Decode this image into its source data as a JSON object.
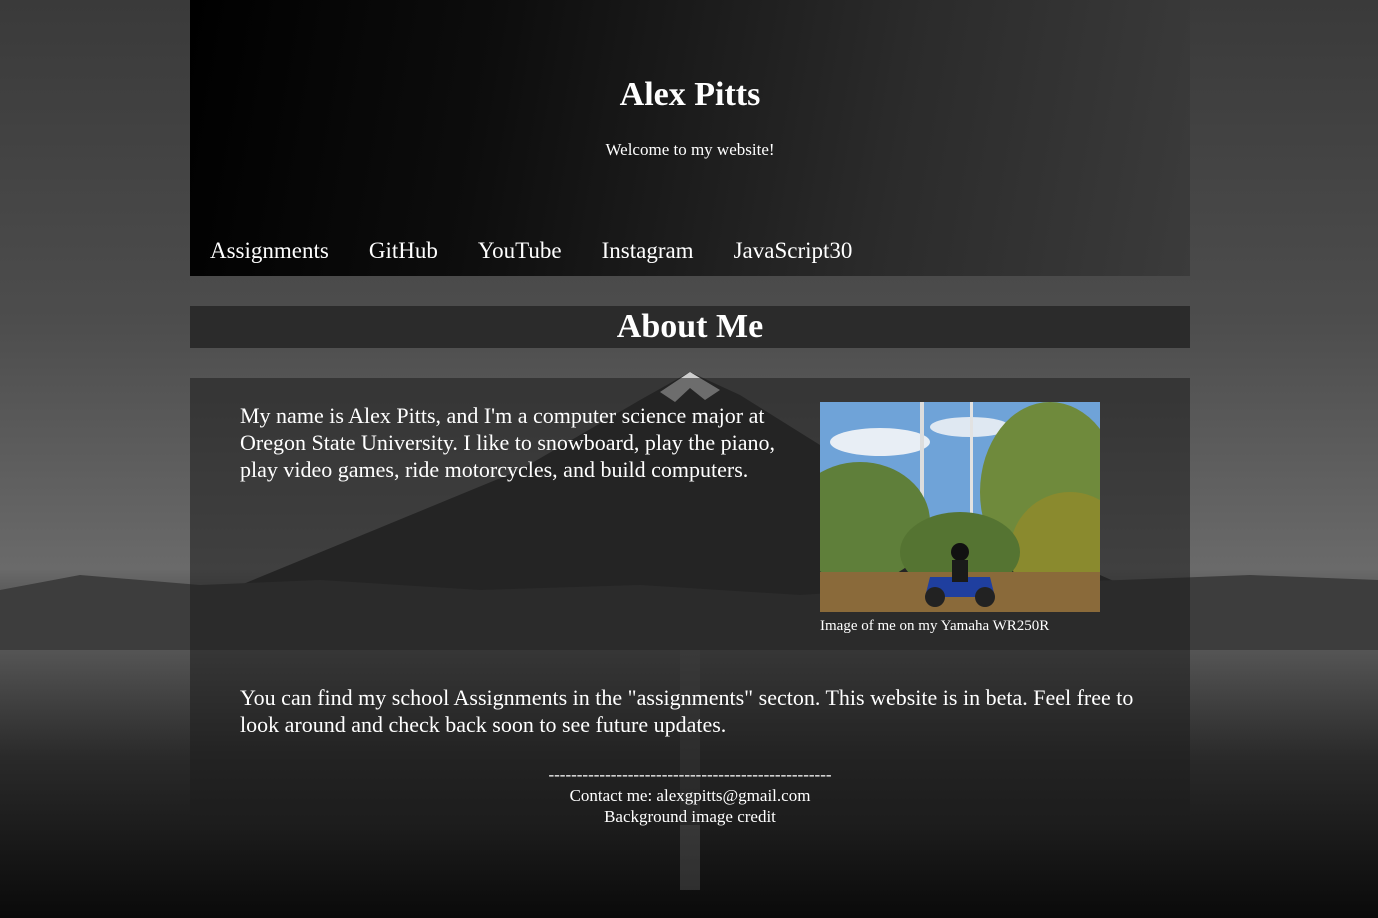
{
  "header": {
    "title": "Alex Pitts",
    "tagline": "Welcome to my website!"
  },
  "nav": {
    "items": [
      {
        "label": "Assignments"
      },
      {
        "label": "GitHub"
      },
      {
        "label": "YouTube"
      },
      {
        "label": "Instagram"
      },
      {
        "label": "JavaScript30"
      }
    ]
  },
  "about": {
    "title": "About Me",
    "intro": "My name is Alex Pitts, and I'm a computer science major at Oregon State University. I like to snowboard, play the piano, play video games, ride motorcycles, and build computers.",
    "photo_caption": "Image of me on my Yamaha WR250R",
    "more": "You can find my school Assignments in the \"assignments\" secton. This website is in beta. Feel free to look around and check back soon to see future updates."
  },
  "footer": {
    "divider": "--------------------------------------------------",
    "contact": "Contact me: alexgpitts@gmail.com",
    "credit": "Background image credit"
  }
}
